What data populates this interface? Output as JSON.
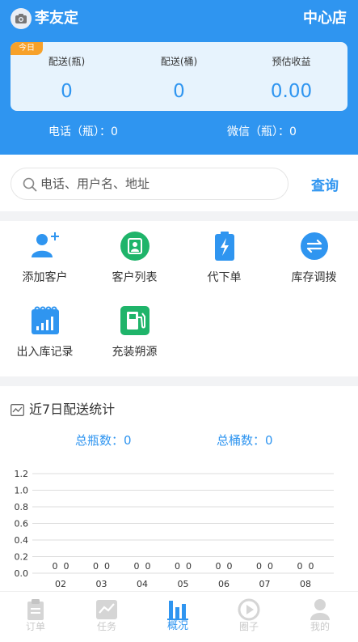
{
  "header": {
    "user_name": "李友定",
    "store_name": "中心店",
    "today_badge": "今日",
    "stats": [
      {
        "label": "配送(瓶)",
        "value": "0"
      },
      {
        "label": "配送(桶)",
        "value": "0"
      },
      {
        "label": "预估收益",
        "value": "0.00"
      }
    ],
    "phone_orders": "电话（瓶）：0",
    "wechat_orders": "微信（瓶）：0"
  },
  "search": {
    "placeholder": "电话、用户名、地址",
    "button_label": "查询"
  },
  "menu": {
    "items": [
      {
        "label": "添加客户",
        "icon": "add-user-icon"
      },
      {
        "label": "客户列表",
        "icon": "customer-card-icon"
      },
      {
        "label": "代下单",
        "icon": "battery-order-icon"
      },
      {
        "label": "库存调拨",
        "icon": "transfer-icon"
      },
      {
        "label": "出入库记录",
        "icon": "calendar-bars-icon"
      },
      {
        "label": "充装朔源",
        "icon": "gas-station-icon"
      }
    ]
  },
  "stats_panel": {
    "title": "近7日配送统计",
    "total_bottles": "总瓶数：0",
    "total_barrels": "总桶数：0"
  },
  "chart_data": {
    "type": "bar",
    "categories": [
      "02",
      "03",
      "04",
      "05",
      "06",
      "07",
      "08"
    ],
    "series": [
      {
        "values": [
          0,
          0,
          0,
          0,
          0,
          0,
          0
        ]
      },
      {
        "values": [
          0,
          0,
          0,
          0,
          0,
          0,
          0
        ]
      }
    ],
    "yticks": [
      "0.0",
      "0.2",
      "0.4",
      "0.6",
      "0.8",
      "1.0",
      "1.2"
    ],
    "ylim": [
      0,
      1.2
    ],
    "grid": true,
    "colors": [
      "#2f95f0",
      "#8ec8f7"
    ]
  },
  "tabbar": {
    "items": [
      {
        "label": "订单",
        "icon": "order-clipboard-icon",
        "active": false
      },
      {
        "label": "任务",
        "icon": "task-chart-icon",
        "active": false
      },
      {
        "label": "概况",
        "icon": "overview-bars-icon",
        "active": true
      },
      {
        "label": "圈子",
        "icon": "circle-play-icon",
        "active": false
      },
      {
        "label": "我的",
        "icon": "profile-icon",
        "active": false
      }
    ]
  },
  "colors": {
    "primary": "#2f95f0",
    "badge": "#f7a12a",
    "green": "#1fb46a"
  }
}
